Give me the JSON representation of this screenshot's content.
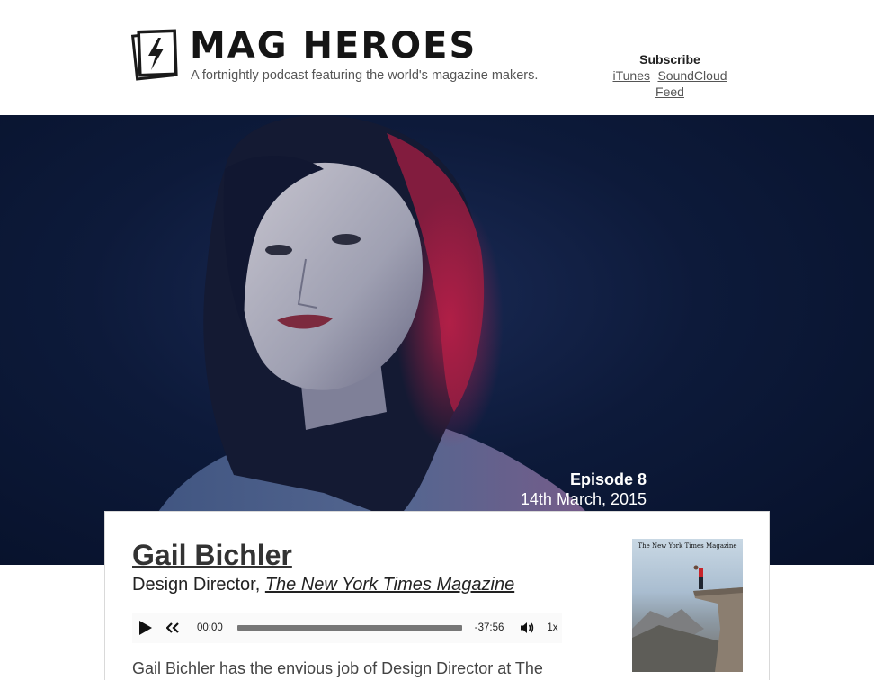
{
  "header": {
    "title": "MAG HEROES",
    "tagline": "A fortnightly podcast featuring the world's magazine makers.",
    "subscribe": {
      "title": "Subscribe",
      "links": [
        "iTunes",
        "SoundCloud",
        "Feed"
      ]
    }
  },
  "episode": {
    "number": "Episode 8",
    "date": "14th March, 2015"
  },
  "guest": {
    "name": "Gail Bichler",
    "role_prefix": "Design Director,",
    "publication": "The New York Times Magazine",
    "description": "Gail Bichler has the envious job of Design Director at The"
  },
  "player": {
    "current_time": "00:00",
    "remaining_time": "-37:56",
    "speed": "1x",
    "progress": 0
  },
  "cover": {
    "masthead": "The New York Times Magazine"
  },
  "colors": {
    "hero_background": "#0d1a3a",
    "text_dark": "#222222",
    "progress_bar": "#777777"
  }
}
